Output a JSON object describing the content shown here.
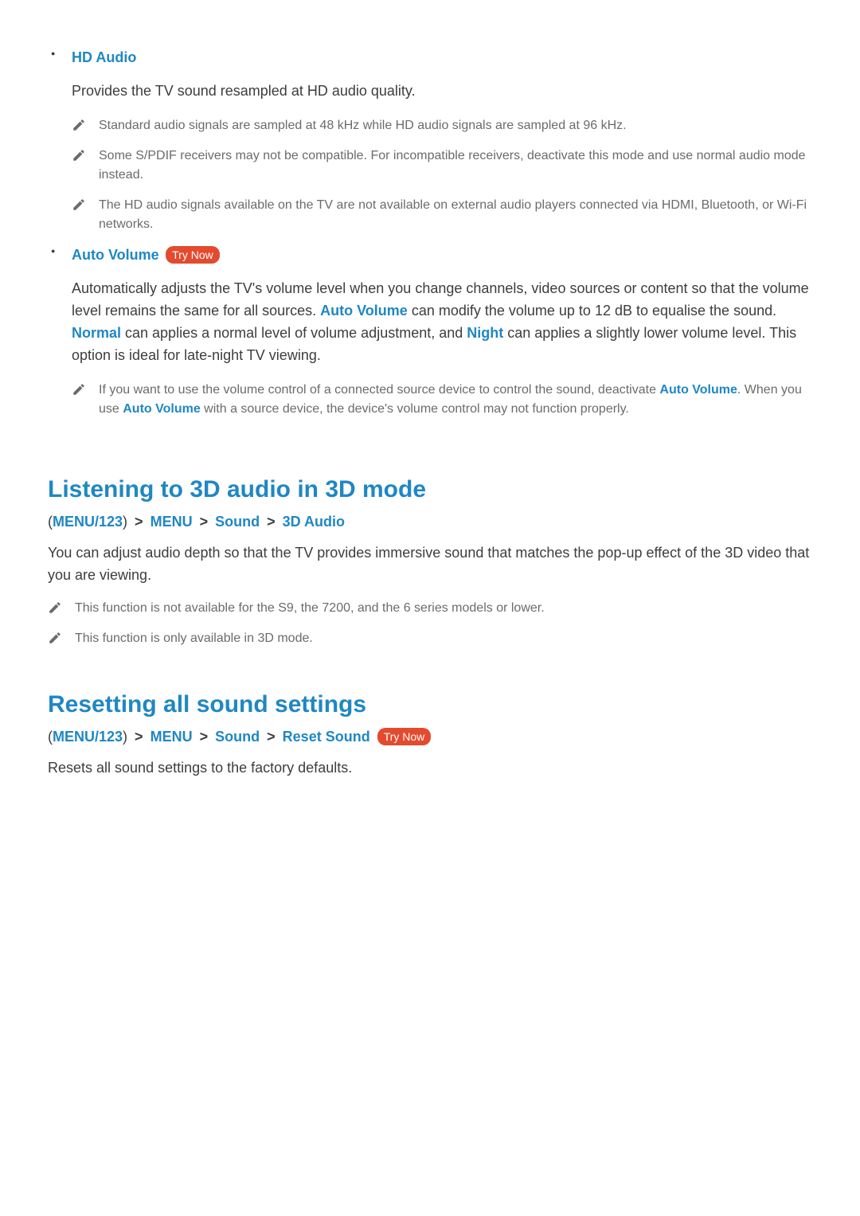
{
  "labels": {
    "try_now": "Try Now"
  },
  "features": [
    {
      "title": "HD Audio",
      "try_now": false,
      "desc_plain": "Provides the TV sound resampled at HD audio quality.",
      "notes": [
        {
          "plain": "Standard audio signals are sampled at 48 kHz while HD audio signals are sampled at 96 kHz."
        },
        {
          "plain": "Some S/PDIF receivers may not be compatible. For incompatible receivers, deactivate this mode and use normal audio mode instead."
        },
        {
          "plain": "The HD audio signals available on the TV are not available on external audio players connected via HDMI, Bluetooth, or Wi-Fi networks."
        }
      ]
    },
    {
      "title": "Auto Volume",
      "try_now": true,
      "desc_parts": {
        "p1": "Automatically adjusts the TV's volume level when you change channels, video sources or content so that the volume level remains the same for all sources. ",
        "t1": "Auto Volume",
        "p2": " can modify the volume up to 12 dB to equalise the sound. ",
        "t2": "Normal",
        "p3": " can applies a normal level of volume adjustment, and ",
        "t3": "Night",
        "p4": " can applies a slightly lower volume level. This option is ideal for late-night TV viewing."
      },
      "notes": [
        {
          "parts": {
            "p1": "If you want to use the volume control of a connected source device to control the sound, deactivate ",
            "t1": "Auto Volume",
            "p2": ". When you use ",
            "t2": "Auto Volume",
            "p3": " with a source device, the device's volume control may not function properly."
          }
        }
      ]
    }
  ],
  "sections": [
    {
      "heading": "Listening to 3D audio in 3D mode",
      "breadcrumb": [
        "MENU/123",
        "MENU",
        "Sound",
        "3D Audio"
      ],
      "try_now": false,
      "body": "You can adjust audio depth so that the TV provides immersive sound that matches the pop-up effect of the 3D video that you are viewing.",
      "notes": [
        {
          "plain": "This function is not available for the S9, the 7200, and the 6 series models or lower."
        },
        {
          "plain": "This function is only available in 3D mode."
        }
      ]
    },
    {
      "heading": "Resetting all sound settings",
      "breadcrumb": [
        "MENU/123",
        "MENU",
        "Sound",
        "Reset Sound"
      ],
      "try_now": true,
      "body": "Resets all sound settings to the factory defaults.",
      "notes": []
    }
  ]
}
